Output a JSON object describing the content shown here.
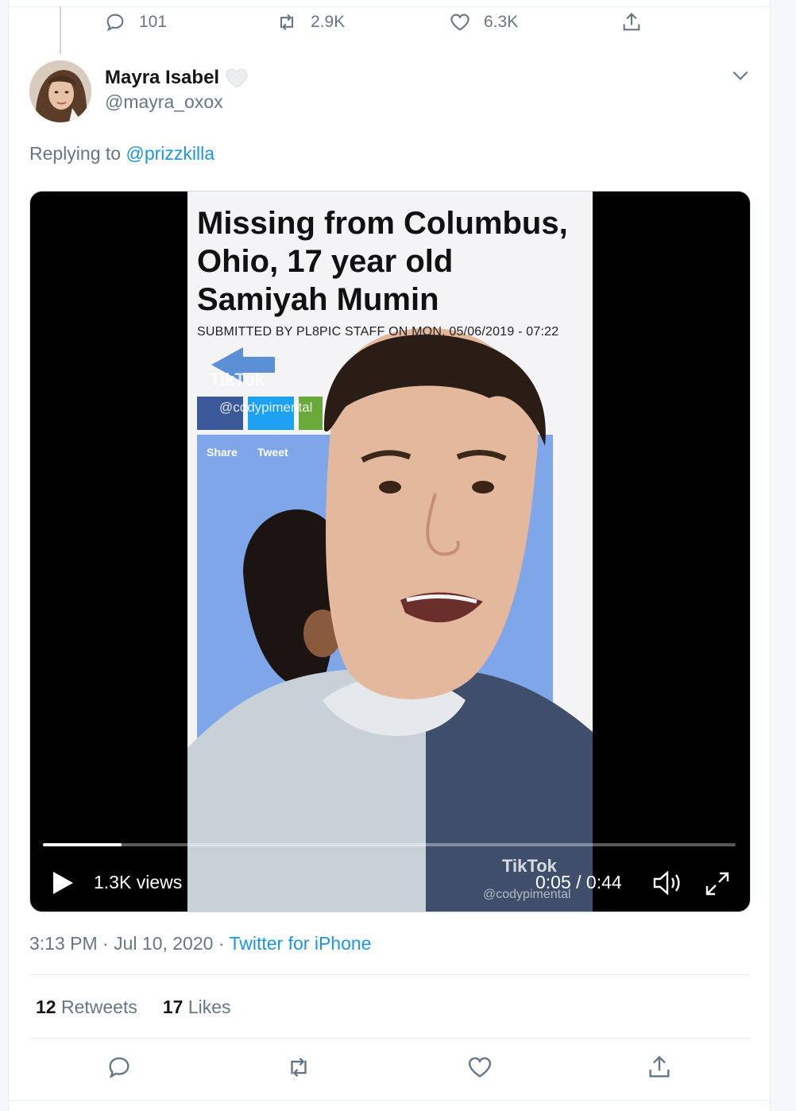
{
  "previous_tweet": {
    "replies": "101",
    "retweets": "2.9K",
    "likes": "6.3K"
  },
  "author": {
    "display_name": "Mayra Isabel",
    "handle": "@mayra_oxox",
    "name_emoji": "white-heart-icon"
  },
  "replying": {
    "prefix": "Replying to",
    "target": "@prizzkilla"
  },
  "video": {
    "headline": [
      "Missing from Columbus,",
      "Ohio, 17 year old",
      "Samiyah Mumin"
    ],
    "submitted": "SUBMITTED BY PL8PIC STAFF ON MON, 05/06/2019 - 07:22",
    "share_label": "Share",
    "tweet_label": "Tweet",
    "watermark_app": "TikTok",
    "watermark_user": "@codypimental",
    "views": "1.3K views",
    "time": "0:05 / 0:44",
    "progress": 0.114
  },
  "meta": {
    "time": "3:13 PM",
    "date": "Jul 10, 2020",
    "separator": "·",
    "source": "Twitter for iPhone"
  },
  "stats": {
    "retweets_count": "12",
    "retweets_label": "Retweets",
    "likes_count": "17",
    "likes_label": "Likes"
  },
  "colors": {
    "link": "#1b95e0",
    "secondary_text": "#657786",
    "border": "#e6ecf0"
  }
}
